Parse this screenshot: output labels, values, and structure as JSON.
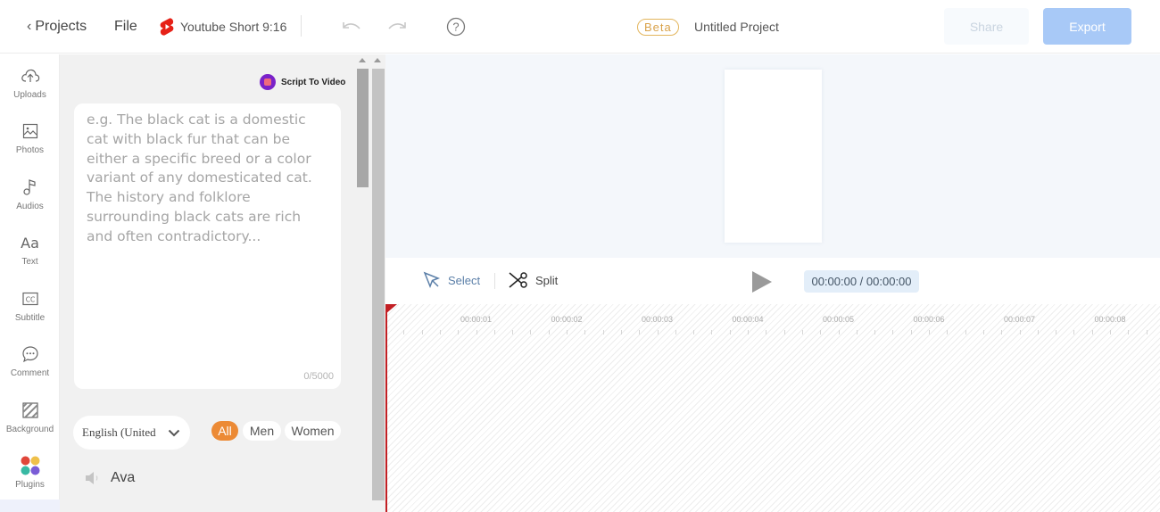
{
  "topbar": {
    "back_label": "Projects",
    "file_label": "File",
    "format_label": "Youtube Short 9:16",
    "beta_label": "Beta",
    "project_title": "Untitled Project",
    "share_label": "Share",
    "export_label": "Export",
    "icons": [
      "chevron-left-icon",
      "youtube-shorts-icon",
      "undo-icon",
      "redo-icon",
      "help-icon"
    ]
  },
  "nav": {
    "items": [
      {
        "label": "Uploads",
        "icon": "upload-cloud-icon"
      },
      {
        "label": "Photos",
        "icon": "image-icon"
      },
      {
        "label": "Audios",
        "icon": "music-note-icon"
      },
      {
        "label": "Text",
        "icon": "text-aa-icon"
      },
      {
        "label": "Subtitle",
        "icon": "cc-icon"
      },
      {
        "label": "Comment",
        "icon": "comment-bubble-icon"
      },
      {
        "label": "Background",
        "icon": "background-stripes-icon"
      },
      {
        "label": "Plugins",
        "icon": "plugins-dots-icon"
      }
    ]
  },
  "panel": {
    "script_to_video_label": "Script To Video",
    "script_placeholder": "e.g. The black cat is a domestic cat with black fur that can be either a specific breed or a color variant of any domesticated cat. The history and folklore surrounding black cats are rich and often contradictory...",
    "char_count": "0/5000",
    "language_value": "English (United States)",
    "filters": [
      {
        "label": "All",
        "active": true
      },
      {
        "label": "Men",
        "active": false
      },
      {
        "label": "Women",
        "active": false
      }
    ],
    "voice_name": "Ava"
  },
  "toolbar": {
    "select_label": "Select",
    "split_label": "Split",
    "timecode": "00:00:00 / 00:00:00"
  },
  "timeline": {
    "labels": [
      "00:00:01",
      "00:00:02",
      "00:00:03",
      "00:00:04",
      "00:00:05",
      "00:00:06",
      "00:00:07",
      "00:00:08"
    ],
    "playhead_time": "00:00:00"
  },
  "colors": {
    "accent_orange": "#ec8a35",
    "export_blue": "#a8c9f7",
    "playhead_red": "#c21f24",
    "beta_gold": "#d9a24a"
  }
}
